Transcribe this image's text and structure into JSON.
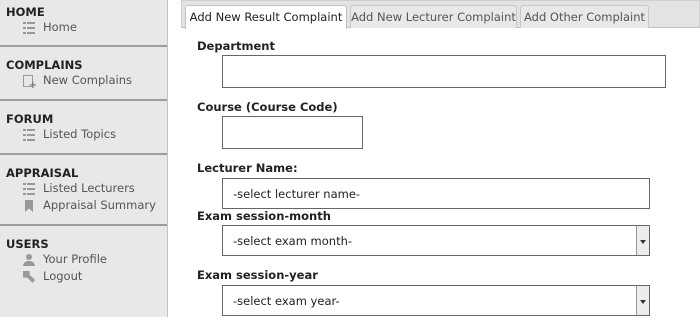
{
  "sidebar": {
    "sections": [
      {
        "title": "HOME",
        "items": [
          {
            "label": "Home",
            "icon": "list-icon"
          }
        ]
      },
      {
        "title": "COMPLAINS",
        "items": [
          {
            "label": "New Complains",
            "icon": "new-document-icon"
          }
        ]
      },
      {
        "title": "FORUM",
        "items": [
          {
            "label": "Listed Topics",
            "icon": "list-icon"
          }
        ]
      },
      {
        "title": "APPRAISAL",
        "items": [
          {
            "label": "Listed Lecturers",
            "icon": "list-icon"
          },
          {
            "label": "Appraisal Summary",
            "icon": "bookmark-icon"
          }
        ]
      },
      {
        "title": "USERS",
        "items": [
          {
            "label": "Your Profile",
            "icon": "user-icon"
          },
          {
            "label": "Logout",
            "icon": "logout-icon"
          }
        ]
      }
    ]
  },
  "tabs": [
    {
      "label": "Add New Result Complaint",
      "active": true
    },
    {
      "label": "Add New Lecturer Complaint",
      "active": false
    },
    {
      "label": "Add Other Complaint",
      "active": false
    }
  ],
  "form": {
    "department": {
      "label": "Department",
      "value": ""
    },
    "course": {
      "label": "Course (Course Code)",
      "value": ""
    },
    "lecturer": {
      "label": "Lecturer Name:",
      "selected": "-select lecturer name-"
    },
    "exam_month": {
      "label": "Exam session-month",
      "selected": "-select exam month-"
    },
    "exam_year": {
      "label": "Exam session-year",
      "selected": "-select exam year-"
    }
  }
}
